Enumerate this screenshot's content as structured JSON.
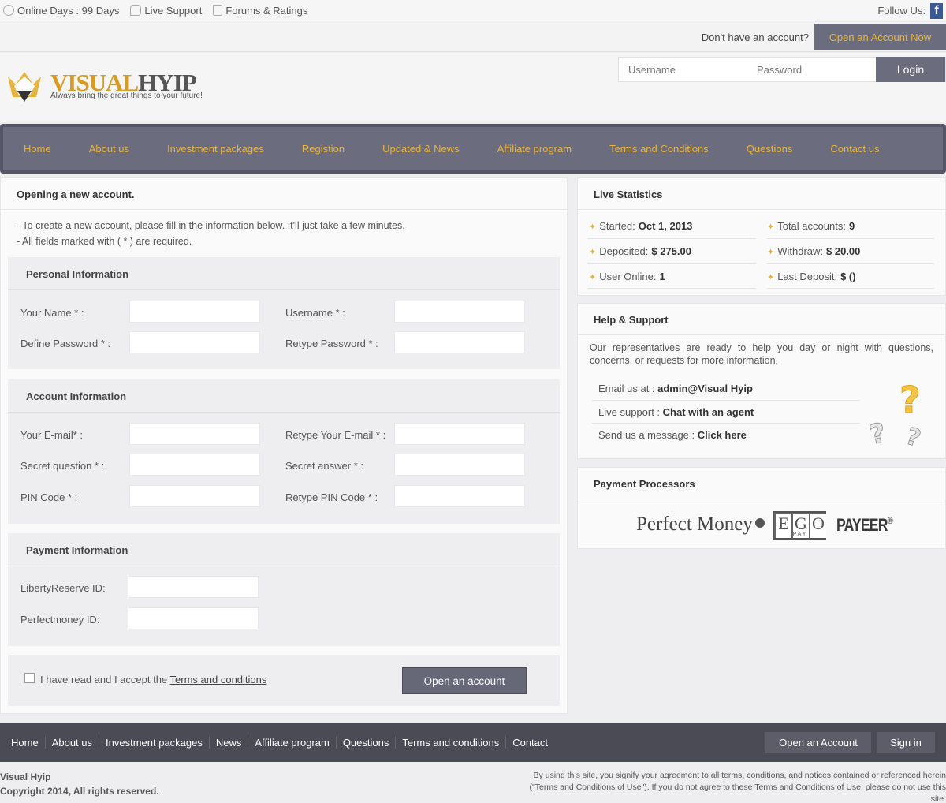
{
  "topbar": {
    "online_days": "Online Days : 99 Days",
    "live_support": "Live Support",
    "forums": "Forums & Ratings",
    "follow_us": "Follow Us:",
    "facebook_glyph": "f"
  },
  "account_bar": {
    "question": "Don't have an account?",
    "open_button": "Open an Account Now"
  },
  "header": {
    "logo_part1": "VISUAL",
    "logo_part2": "HYIP",
    "tagline": "Always bring the great things to your future!",
    "username_placeholder": "Username",
    "password_placeholder": "Password",
    "login_button": "Login"
  },
  "nav": {
    "items": [
      "Home",
      "About us",
      "Investment packages",
      "Registion",
      "Updated & News",
      "Affiliate program",
      "Terms and Conditions",
      "Questions",
      "Contact us"
    ]
  },
  "register": {
    "title": "Opening a new account.",
    "intro_line1": "- To create a new account, please fill in the information below. It'll just take a few minutes.",
    "intro_line2": "- All fields marked with ( * ) are required.",
    "personal": {
      "title": "Personal Information",
      "your_name": "Your Name * :",
      "username": "Username * :",
      "define_password": "Define Password * :",
      "retype_password": "Retype Password * :"
    },
    "account": {
      "title": "Account Information",
      "email": "Your E-mail* :",
      "retype_email": "Retype Your E-mail * :",
      "secret_question": "Secret question * :",
      "secret_answer": "Secret answer * :",
      "pin": "PIN Code * :",
      "retype_pin": "Retype PIN Code * :"
    },
    "payment": {
      "title": "Payment Information",
      "liberty": "LibertyReserve ID:",
      "perfectmoney": "Perfectmoney ID:"
    },
    "agree_text": "I have read and I accept the ",
    "terms_link": "Terms and conditions",
    "submit_button": "Open an account"
  },
  "stats": {
    "title": "Live Statistics",
    "started_label": "Started:",
    "started_value": "Oct 1, 2013",
    "total_label": "Total accounts:",
    "total_value": "9",
    "deposited_label": "Deposited:",
    "deposited_value": "$ 275.00",
    "withdraw_label": "Withdraw:",
    "withdraw_value": "$ 20.00",
    "online_label": "User Online:",
    "online_value": "1",
    "last_label": "Last Deposit:",
    "last_value": "$ ()"
  },
  "help": {
    "title": "Help & Support",
    "text": "Our representatives are ready to help you day or night with questions, concerns, or requests for more information.",
    "email_label": "Email us at : ",
    "email_value": "admin@Visual Hyip",
    "live_label": "Live support : ",
    "live_value": "Chat with an agent",
    "message_label": "Send us a message : ",
    "message_value": "Click here"
  },
  "processors": {
    "title": "Payment Processors",
    "perfect_money": "Perfect Money",
    "egopay_letters": [
      "E",
      "G",
      "O"
    ],
    "egopay_sub": "P A Y",
    "payeer": "PAYEER"
  },
  "footer": {
    "links": [
      "Home",
      "About us",
      "Investment packages",
      "News",
      "Affiliate program",
      "Questions",
      "Terms and conditions",
      "Contact"
    ],
    "open_account": "Open an Account",
    "sign_in": "Sign in",
    "site_name": "Visual Hyip",
    "copyright": "Copyright 2014, All rights reserved.",
    "legal": "By using this site, you signify your agreement to all terms, conditions, and notices contained or referenced herein (\"Terms and Conditions of Use\"). If you do not agree to these Terms and Conditions of Use, please do not use this site."
  },
  "colors": {
    "accent": "#e8b43a",
    "nav_bg": "#6b6d7e",
    "footer_bg": "#4a4b54"
  }
}
